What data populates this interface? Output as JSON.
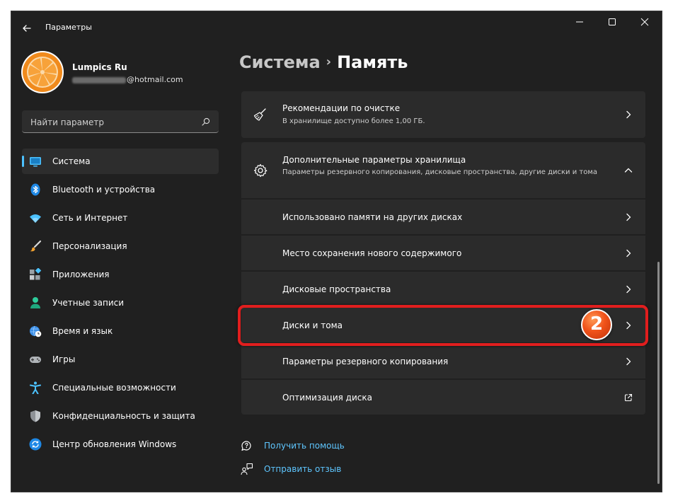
{
  "window": {
    "title": "Параметры"
  },
  "profile": {
    "name": "Lumpics Ru",
    "email_visible": "@hotmail.com"
  },
  "search": {
    "placeholder": "Найти параметр"
  },
  "nav": {
    "items": [
      {
        "label": "Система",
        "icon": "monitor-icon",
        "active": true
      },
      {
        "label": "Bluetooth и устройства",
        "icon": "bluetooth-icon"
      },
      {
        "label": "Сеть и Интернет",
        "icon": "wifi-icon"
      },
      {
        "label": "Персонализация",
        "icon": "brush-icon"
      },
      {
        "label": "Приложения",
        "icon": "apps-icon"
      },
      {
        "label": "Учетные записи",
        "icon": "person-icon"
      },
      {
        "label": "Время и язык",
        "icon": "globe-clock-icon"
      },
      {
        "label": "Игры",
        "icon": "gamepad-icon"
      },
      {
        "label": "Специальные возможности",
        "icon": "accessibility-icon"
      },
      {
        "label": "Конфиденциальность и защита",
        "icon": "shield-icon"
      },
      {
        "label": "Центр обновления Windows",
        "icon": "update-icon"
      }
    ]
  },
  "breadcrumb": {
    "parent": "Система",
    "separator": "›",
    "current": "Память"
  },
  "cleanup": {
    "title": "Рекомендации по очистке",
    "desc": "В хранилище доступно более 1,00 ГБ."
  },
  "advanced": {
    "title": "Дополнительные параметры хранилища",
    "desc": "Параметры резервного копирования, дисковые пространства, другие диски и тома",
    "expanded": true,
    "items": [
      {
        "label": "Использовано памяти на других дисках",
        "icon": "chevron-right-icon"
      },
      {
        "label": "Место сохранения нового содержимого",
        "icon": "chevron-right-icon"
      },
      {
        "label": "Дисковые пространства",
        "icon": "chevron-right-icon"
      },
      {
        "label": "Диски и тома",
        "icon": "chevron-right-icon",
        "highlighted": true
      },
      {
        "label": "Параметры резервного копирования",
        "icon": "chevron-right-icon"
      },
      {
        "label": "Оптимизация диска",
        "icon": "external-link-icon"
      }
    ]
  },
  "annotation": {
    "step": "2",
    "color": "#e11e1e"
  },
  "links": {
    "help": "Получить помощь",
    "feedback": "Отправить отзыв"
  },
  "colors": {
    "accent": "#4cc2ff",
    "link": "#5ec6ff",
    "background": "#202020",
    "card": "#2b2b2b"
  }
}
